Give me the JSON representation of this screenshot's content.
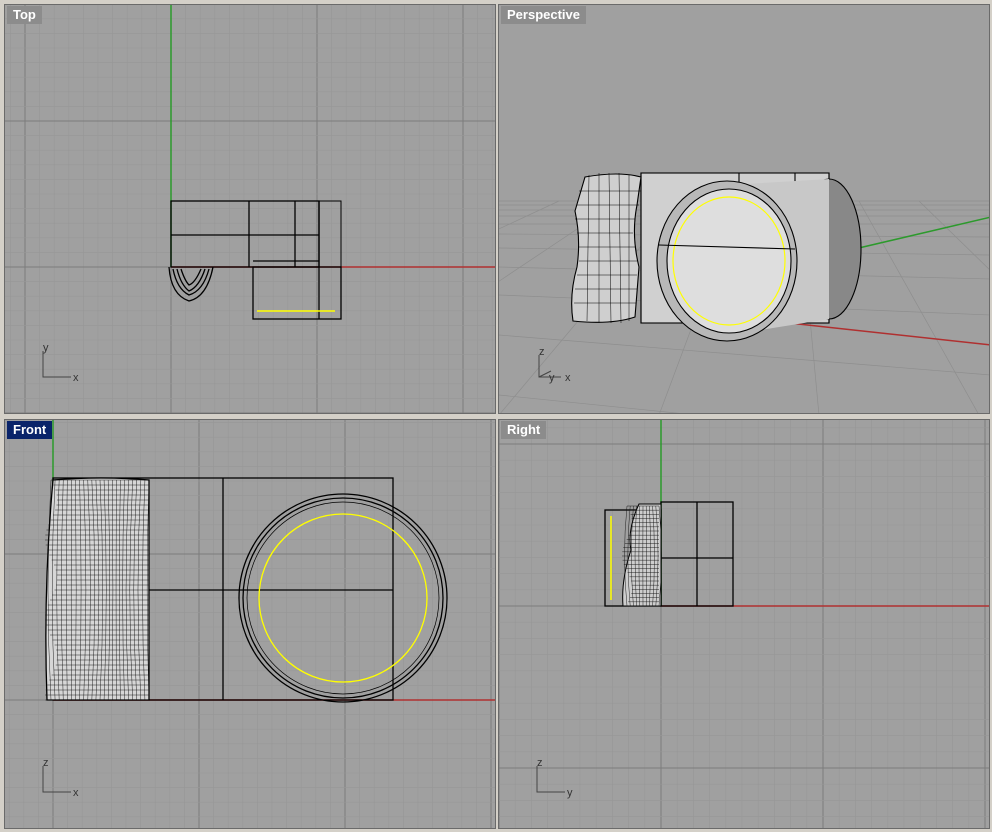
{
  "viewports": {
    "top": {
      "title": "Top",
      "active": false,
      "axis_h": "x",
      "axis_v": "y"
    },
    "perspective": {
      "title": "Perspective",
      "active": false,
      "axis_h": "x",
      "axis_v": "z",
      "axis_d": "y"
    },
    "front": {
      "title": "Front",
      "active": true,
      "axis_h": "x",
      "axis_v": "z"
    },
    "right": {
      "title": "Right",
      "active": false,
      "axis_h": "y",
      "axis_v": "z"
    }
  },
  "colors": {
    "viewport_bg": "#a0a0a0",
    "grid_minor": "#979797",
    "grid_major": "#7c7c7c",
    "axis_x": "#b03030",
    "axis_y": "#2c9a2c",
    "geometry": "#000000",
    "highlight_curve": "#ffff00",
    "active_title_bg": "#0a246a",
    "inactive_title_bg": "#8c8c8c"
  },
  "icons": [
    "axis-gizmo-icon"
  ]
}
